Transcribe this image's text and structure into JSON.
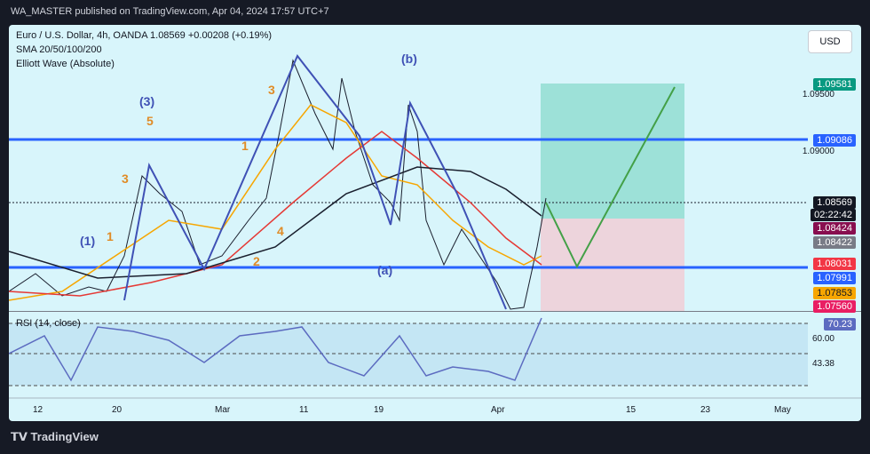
{
  "header": {
    "text": "WA_MASTER published on TradingView.com, Apr 04, 2024 17:57 UTC+7"
  },
  "chart_info": {
    "symbol": "Euro / U.S. Dollar, 4h, OANDA",
    "last": "1.08569",
    "change": "+0.00208 (+0.19%)",
    "indicator1": "SMA 20/50/100/200",
    "indicator2": "Elliott Wave (Absolute)"
  },
  "currency_button": "USD",
  "price_tags": [
    {
      "label": "1.09581",
      "color": "#089981"
    },
    {
      "label": "1.09086",
      "color": "#2962ff"
    },
    {
      "label": "1.08569",
      "color": "#131722"
    },
    {
      "label": "02:22:42",
      "color": "#131722"
    },
    {
      "label": "1.08424",
      "color": "#880e4f"
    },
    {
      "label": "1.08422",
      "color": "#787b86"
    },
    {
      "label": "1.08031",
      "color": "#f23645"
    },
    {
      "label": "1.07991",
      "color": "#2962ff"
    },
    {
      "label": "1.07853",
      "color": "#f7a600"
    },
    {
      "label": "1.07560",
      "color": "#e91e63"
    }
  ],
  "price_axis": [
    "1.09500",
    "1.09000"
  ],
  "rsi": {
    "title": "RSI (14, close)",
    "value": "70.23",
    "level1": "60.00",
    "level2": "43.38"
  },
  "time_axis": [
    "12",
    "20",
    "Mar",
    "11",
    "19",
    "Apr",
    "15",
    "23",
    "May"
  ],
  "wave_labels": [
    {
      "text": "(1)",
      "color": "#3f51b5"
    },
    {
      "text": "1",
      "color": "#e08b26"
    },
    {
      "text": "3",
      "color": "#e08b26"
    },
    {
      "text": "(3)",
      "color": "#3f51b5"
    },
    {
      "text": "5",
      "color": "#e08b26"
    },
    {
      "text": "1",
      "color": "#e08b26"
    },
    {
      "text": "3",
      "color": "#e08b26"
    },
    {
      "text": "2",
      "color": "#e08b26"
    },
    {
      "text": "4",
      "color": "#e08b26"
    },
    {
      "text": "(b)",
      "color": "#3f51b5"
    },
    {
      "text": "(a)",
      "color": "#3f51b5"
    }
  ],
  "footer": "TradingView",
  "chart_data": {
    "type": "line",
    "x": [
      "12",
      "20",
      "Mar",
      "11",
      "19",
      "Apr",
      "15",
      "23",
      "May"
    ],
    "series": [],
    "horizontal_levels": [
      1.09086,
      1.07991
    ],
    "projection_box": {
      "target": 1.09581,
      "entry": 1.08424,
      "stop": 1.0756
    },
    "rsi_levels": [
      70.23,
      60.0,
      43.38
    ],
    "colors": {
      "background": "#d8f5fb",
      "level_line": "#2962ff",
      "target_zone": "#8fdcd0",
      "stop_zone": "#f0d0d8"
    }
  }
}
